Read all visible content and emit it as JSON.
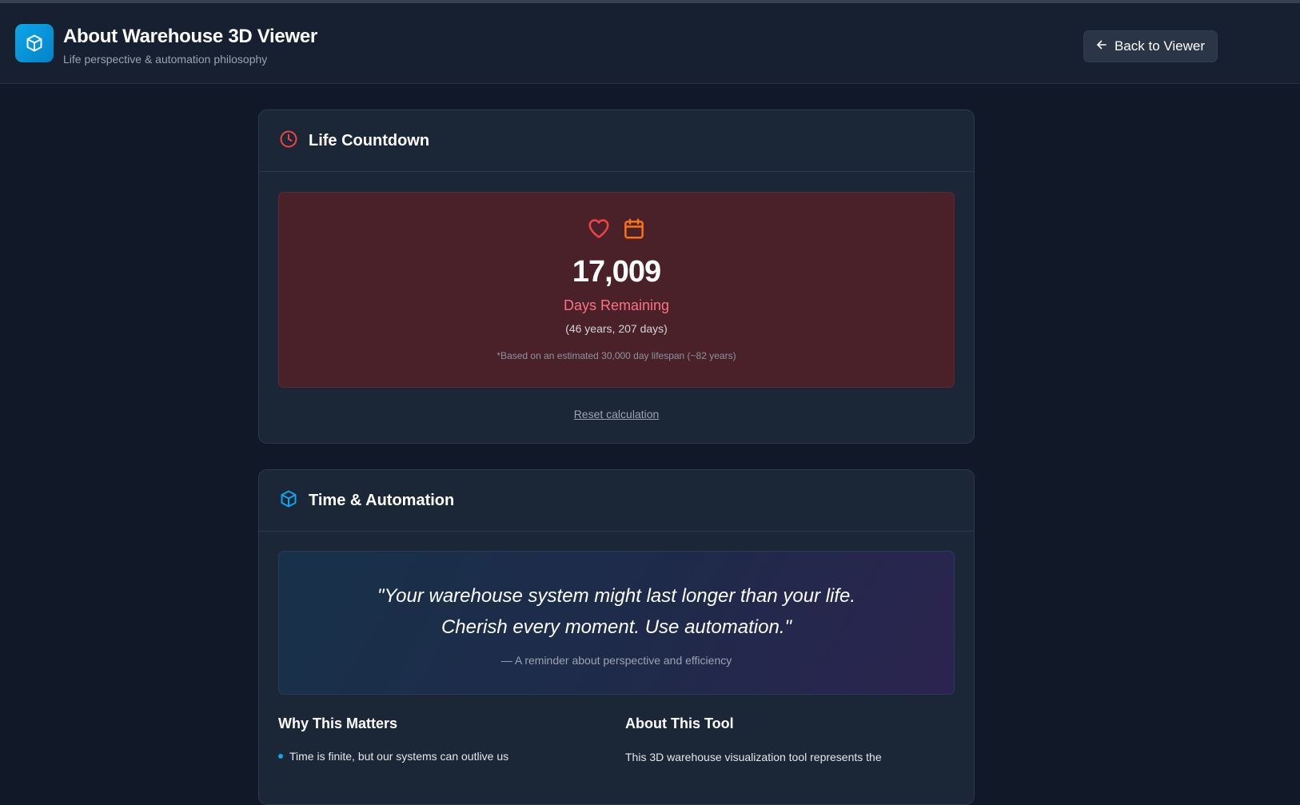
{
  "header": {
    "logo_icon": "box-icon",
    "title": "About Warehouse 3D Viewer",
    "subtitle": "Life perspective & automation philosophy",
    "back_button": {
      "icon": "arrow-left-icon",
      "label": "Back to Viewer"
    }
  },
  "countdown_card": {
    "icon": "clock-icon",
    "title": "Life Countdown",
    "icons": [
      "heart-icon",
      "calendar-icon"
    ],
    "days_remaining": "17,009",
    "label": "Days Remaining",
    "breakdown": "(46 years, 207 days)",
    "note": "*Based on an estimated 30,000 day lifespan (~82 years)",
    "reset_label": "Reset calculation"
  },
  "automation_card": {
    "icon": "box-icon",
    "title": "Time & Automation",
    "quote_line1": "\"Your warehouse system might last longer than your life.",
    "quote_line2": "Cherish every moment. Use automation.\"",
    "quote_attribution": "— A reminder about perspective and efficiency",
    "why_heading": "Why This Matters",
    "why_items": [
      "Time is finite, but our systems can outlive us"
    ],
    "about_heading": "About This Tool",
    "about_text": "This 3D warehouse visualization tool represents the"
  },
  "colors": {
    "background": "#111827",
    "card": "#1b2636",
    "accent": "#0ea5e9",
    "danger": "#ef4444",
    "calendar": "#f97316"
  }
}
